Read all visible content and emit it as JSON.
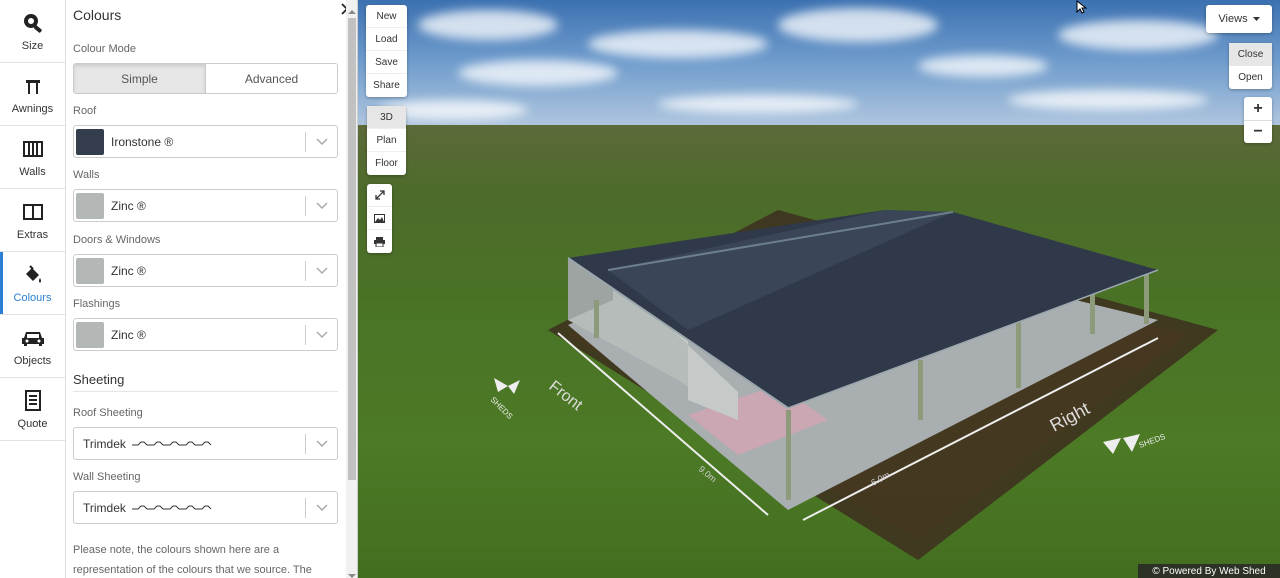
{
  "nav": {
    "items": [
      {
        "label": "Size",
        "icon": "size-icon"
      },
      {
        "label": "Awnings",
        "icon": "awning-icon"
      },
      {
        "label": "Walls",
        "icon": "walls-icon"
      },
      {
        "label": "Extras",
        "icon": "extras-icon"
      },
      {
        "label": "Colours",
        "icon": "paint-bucket-icon",
        "active": true
      },
      {
        "label": "Objects",
        "icon": "car-icon"
      },
      {
        "label": "Quote",
        "icon": "document-icon"
      }
    ]
  },
  "panel": {
    "title": "Colours",
    "colour_mode": {
      "label": "Colour Mode",
      "options": [
        "Simple",
        "Advanced"
      ],
      "selected": "Simple"
    },
    "roof": {
      "label": "Roof",
      "value": "Ironstone ®",
      "swatch": "#333d4b"
    },
    "walls": {
      "label": "Walls",
      "value": "Zinc ®",
      "swatch": "#b3b7b6"
    },
    "doors_windows": {
      "label": "Doors & Windows",
      "value": "Zinc ®",
      "swatch": "#b3b7b6"
    },
    "flashings": {
      "label": "Flashings",
      "value": "Zinc ®",
      "swatch": "#b3b7b6"
    },
    "sheeting": {
      "title": "Sheeting",
      "roof_sheeting": {
        "label": "Roof Sheeting",
        "value": "Trimdek"
      },
      "wall_sheeting": {
        "label": "Wall Sheeting",
        "value": "Trimdek"
      }
    },
    "note": "Please note, the colours shown here are a representation of the colours that we source. The"
  },
  "toolbar": {
    "file": [
      "New",
      "Load",
      "Save",
      "Share"
    ],
    "view_modes": [
      "3D",
      "Plan",
      "Floor"
    ],
    "active_view": "3D",
    "tools": [
      "expand-icon",
      "image-icon",
      "print-icon"
    ]
  },
  "views": {
    "label": "Views"
  },
  "close_open": [
    "Close",
    "Open"
  ],
  "close_open_active": "Close",
  "zoom": {
    "in": "+",
    "out": "−"
  },
  "scene_labels": {
    "front": "Front",
    "right": "Right",
    "brand": "SHEDS",
    "dim_front": "9.0m",
    "dim_right": "6.0m"
  },
  "footer": {
    "powered": "©   Powered By Web Shed"
  },
  "colors": {
    "accent": "#2a7fd4",
    "roof": "#333d4b",
    "zinc": "#b3b7b6"
  }
}
